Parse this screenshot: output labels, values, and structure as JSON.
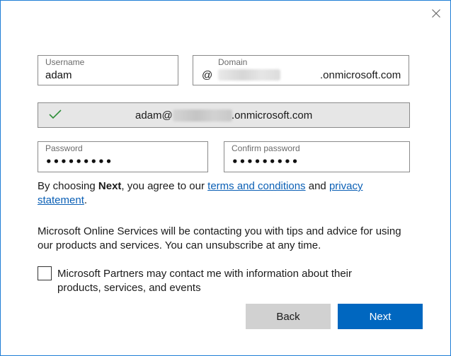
{
  "username": {
    "label": "Username",
    "value": "adam"
  },
  "domain": {
    "label": "Domain",
    "at": "@",
    "suffix": ".onmicrosoft.com"
  },
  "summary": {
    "user": "adam@",
    "domain_suffix": ".onmicrosoft.com"
  },
  "password": {
    "label": "Password",
    "mask": "•••••••••"
  },
  "confirm_password": {
    "label": "Confirm password",
    "mask": "•••••••••"
  },
  "agreement": {
    "prefix": "By choosing ",
    "bold": "Next",
    "middle": ", you agree to our ",
    "terms_link": "terms and conditions",
    "and": " and ",
    "privacy_link": "privacy statement",
    "end": "."
  },
  "info_text": "Microsoft Online Services will be contacting you with tips and advice for using our products and services. You can unsubscribe at any time.",
  "partners_checkbox": {
    "label": "Microsoft Partners may contact me with information about their products, services, and events",
    "checked": false
  },
  "buttons": {
    "back": "Back",
    "next": "Next"
  },
  "colors": {
    "accent": "#0067c0",
    "check": "#2f8f3a",
    "link": "#0a5fb5"
  }
}
